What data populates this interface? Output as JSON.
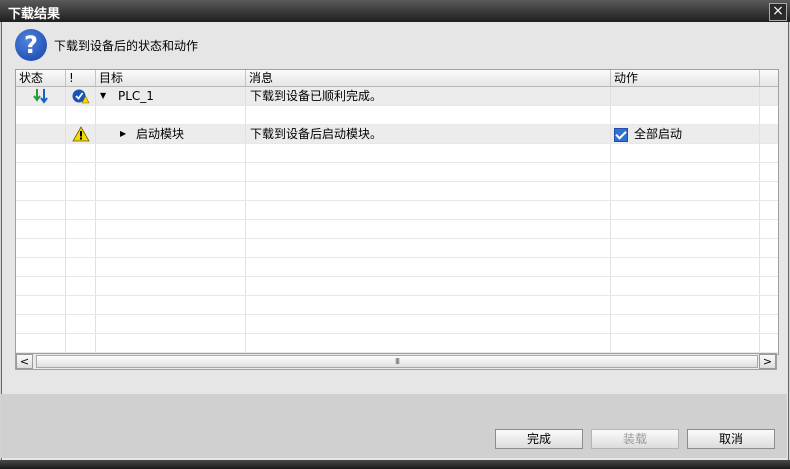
{
  "window": {
    "title": "下载结果",
    "close_icon": "×"
  },
  "header": {
    "question_icon": "?",
    "text": "下载到设备后的状态和动作"
  },
  "table": {
    "columns": [
      "状态",
      "!",
      "目标",
      "消息",
      "动作"
    ],
    "rows": [
      {
        "status_icon": "download-arrows-icon",
        "flag_icon": "check-ok-icon",
        "target_toggle": "▼",
        "target": "PLC_1",
        "message": "下载到设备已顺利完成。",
        "action": ""
      },
      {
        "status_icon": "",
        "flag_icon": "",
        "target_toggle": "",
        "target": "",
        "message": "",
        "action": ""
      },
      {
        "status_icon": "",
        "flag_icon": "warning-icon",
        "target_toggle": "▶",
        "target": "启动模块",
        "message": "下载到设备后启动模块。",
        "action": "全部启动",
        "action_checked": true
      }
    ]
  },
  "scrollbar": {
    "left": "<",
    "right": ">",
    "grip": "III"
  },
  "buttons": {
    "finish": "完成",
    "load": "装载",
    "cancel": "取消"
  },
  "colors": {
    "title_bar": "#2b2b2b",
    "accent": "#1a4fb8",
    "warning": "#f2d900"
  }
}
